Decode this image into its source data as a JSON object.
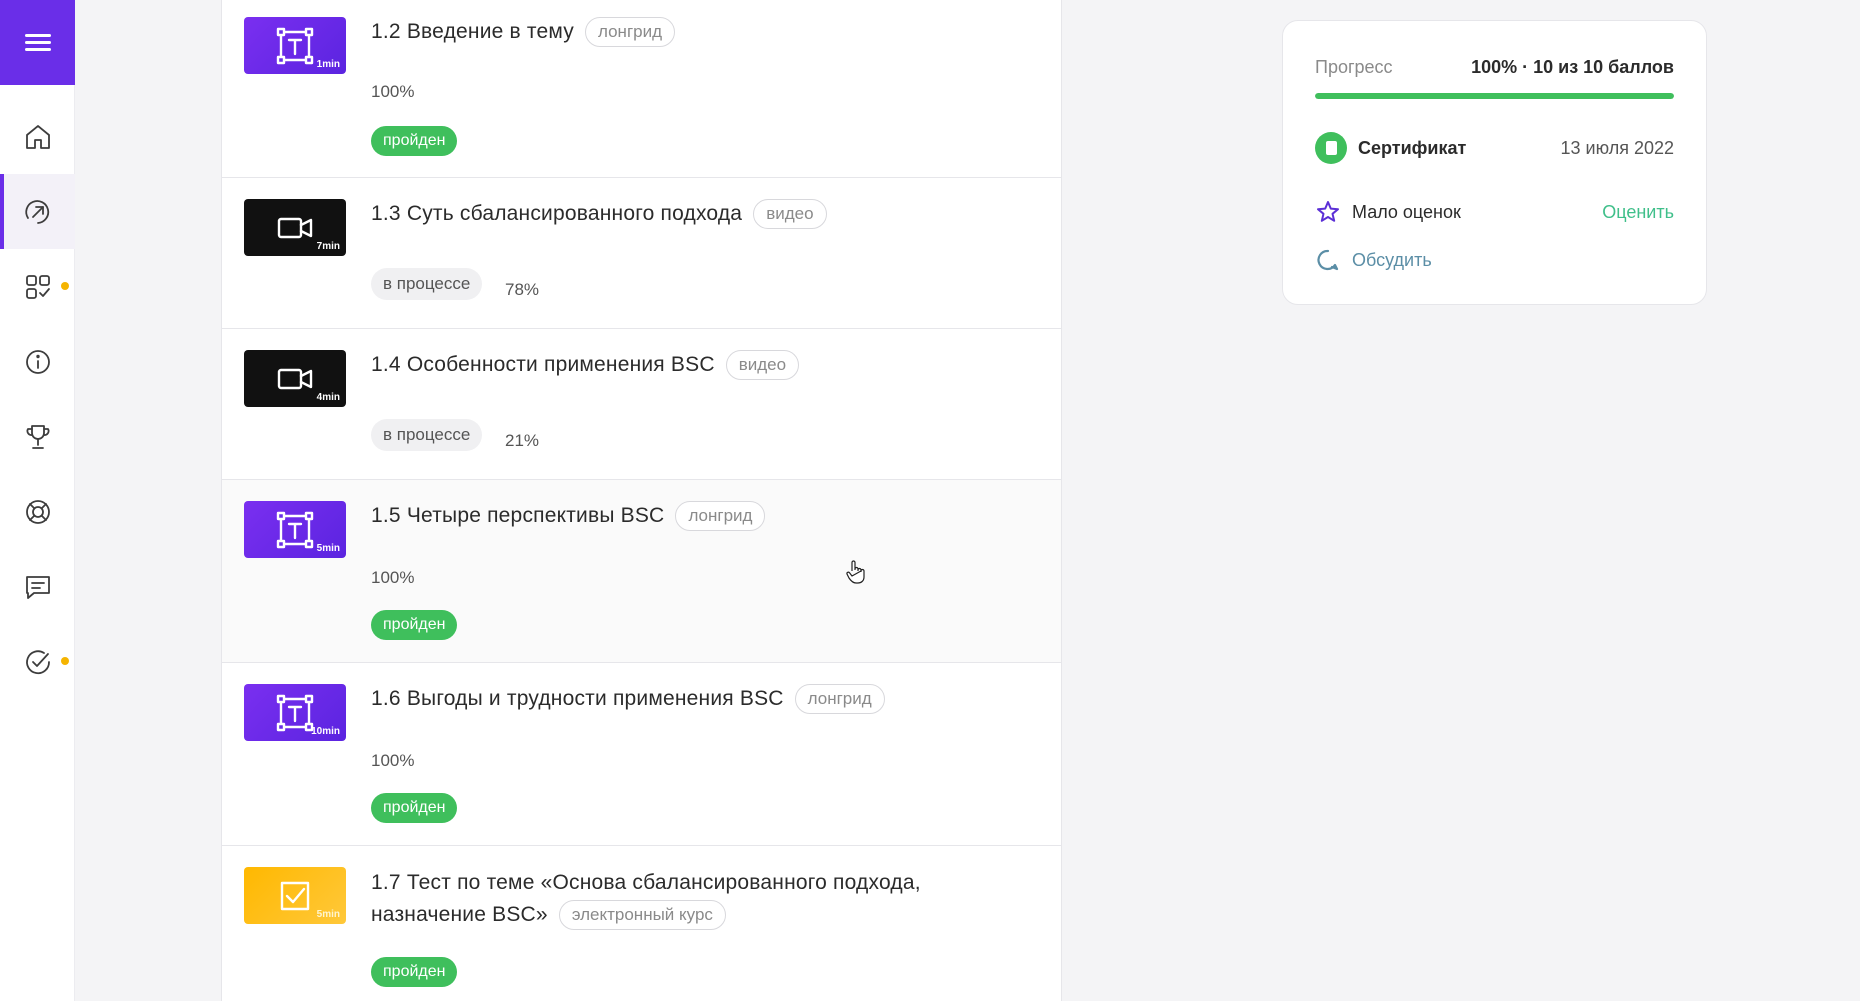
{
  "sidebar": {
    "items": [
      {
        "name": "home-icon"
      },
      {
        "name": "courses-icon",
        "active": true
      },
      {
        "name": "catalog-icon",
        "dot": true
      },
      {
        "name": "info-icon"
      },
      {
        "name": "trophy-icon"
      },
      {
        "name": "support-icon"
      },
      {
        "name": "chat-icon"
      },
      {
        "name": "tasks-icon",
        "dot": true
      }
    ],
    "dot_color": "#f5b400",
    "accent": "#6a2ee8"
  },
  "lessons": [
    {
      "title": "1.2 Введение в тему",
      "tag": "лонгрид",
      "duration": "1min",
      "thumb": "text-icon",
      "percent": "100%",
      "status": "пройден"
    },
    {
      "title": "1.3 Суть сбалансированного подхода",
      "tag": "видео",
      "duration": "7min",
      "thumb": "video-camera-icon",
      "status": "в процессе",
      "percent": "78%"
    },
    {
      "title": "1.4 Особенности применения BSC",
      "tag": "видео",
      "duration": "4min",
      "thumb": "video-camera-icon",
      "status": "в процессе",
      "percent": "21%"
    },
    {
      "title": "1.5 Четыре перспективы BSC",
      "tag": "лонгрид",
      "duration": "5min",
      "thumb": "text-icon",
      "percent": "100%",
      "status": "пройден"
    },
    {
      "title": "1.6 Выгоды и трудности применения BSC",
      "tag": "лонгрид",
      "duration": "10min",
      "thumb": "text-icon",
      "percent": "100%",
      "status": "пройден"
    },
    {
      "title_line1": "1.7 Тест по теме «Основа сбалансированного подхода,",
      "title_line2": "назначение BSC»",
      "tag": "электронный курс",
      "duration": "5min",
      "thumb": "checkbox-icon",
      "status": "пройден"
    }
  ],
  "progress_card": {
    "label": "Прогресс",
    "value": "100% · 10 из 10 баллов",
    "fill": 1.0,
    "certificate_label": "Сертификат",
    "certificate_date": "13 июля 2022",
    "rating_label": "Мало оценок",
    "rate_link": "Оценить",
    "discuss_label": "Обсудить"
  },
  "colors": {
    "done_badge": "#3fbf5c",
    "purple_thumb": "#6a2ee8",
    "yellow_thumb": "#ffb800",
    "link_green": "#3fbf8a"
  }
}
